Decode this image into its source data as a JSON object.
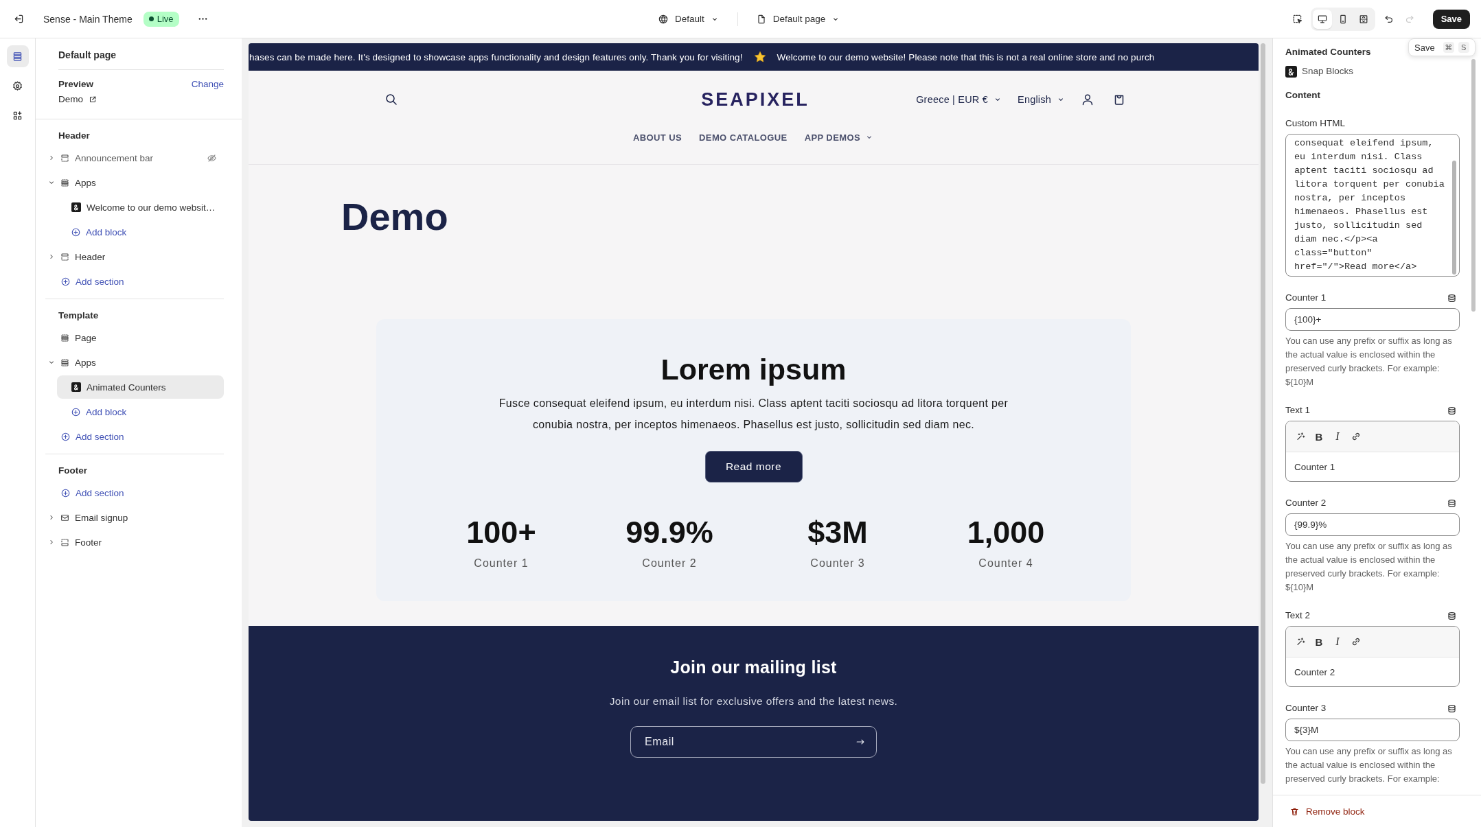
{
  "top_bar": {
    "theme_name": "Sense - Main Theme",
    "status_badge": "Live",
    "template_selector": "Default",
    "page_selector": "Default page",
    "view_modes": [
      {
        "kind": "desktop",
        "selected": true
      },
      {
        "kind": "mobile",
        "selected": false
      },
      {
        "kind": "fullscreen",
        "selected": false
      }
    ],
    "history": [
      {
        "kind": "undo",
        "disabled": false
      },
      {
        "kind": "redo",
        "disabled": true
      }
    ],
    "save_button": "Save"
  },
  "rail": [
    {
      "kind": "sections",
      "selected": true
    },
    {
      "kind": "settings",
      "selected": false
    },
    {
      "kind": "apps",
      "selected": false
    }
  ],
  "sidebar": {
    "title": "Default page",
    "preview": {
      "label": "Preview",
      "action": "Change",
      "value": "Demo"
    },
    "groups": [
      {
        "heading": "Header",
        "items": [
          {
            "kind": "announcement",
            "label": "Announcement bar",
            "expanded": false,
            "hidden": true
          },
          {
            "kind": "apps",
            "label": "Apps",
            "expanded": true,
            "hidden": false,
            "children": [
              {
                "kind": "block",
                "label": "Welcome to our demo websit…",
                "selected": false
              },
              {
                "kind": "add",
                "label": "Add block"
              }
            ]
          },
          {
            "kind": "header",
            "label": "Header",
            "expanded": false,
            "hidden": false
          },
          {
            "kind": "add",
            "label": "Add section"
          }
        ]
      },
      {
        "heading": "Template",
        "items": [
          {
            "kind": "page",
            "label": "Page",
            "hidden": false
          },
          {
            "kind": "apps",
            "label": "Apps",
            "expanded": true,
            "hidden": false,
            "children": [
              {
                "kind": "block",
                "label": "Animated Counters",
                "selected": true
              },
              {
                "kind": "add",
                "label": "Add block"
              }
            ]
          },
          {
            "kind": "add",
            "label": "Add section"
          }
        ]
      },
      {
        "heading": "Footer",
        "items": [
          {
            "kind": "add",
            "label": "Add section"
          },
          {
            "kind": "email",
            "label": "Email signup",
            "expanded": false,
            "hidden": false
          },
          {
            "kind": "footer",
            "label": "Footer",
            "expanded": false,
            "hidden": false
          }
        ]
      }
    ]
  },
  "preview": {
    "announcement_bar": {
      "messages": [
        "hases can be made here. It's designed to showcase apps functionality and design features only. Thank you for visiting!",
        "Welcome to our demo website! Please note that this is not a real online store and no purch"
      ]
    },
    "store_header": {
      "logo": "SEAPIXEL",
      "localization": [
        "Greece | EUR €",
        "English"
      ],
      "menu": [
        {
          "label": "ABOUT US",
          "dropdown": false
        },
        {
          "label": "DEMO CATALOGUE",
          "dropdown": false
        },
        {
          "label": "APP DEMOS",
          "dropdown": true
        }
      ]
    },
    "page_title": "Demo",
    "counters_block": {
      "heading": "Lorem ipsum",
      "text": "Fusce consequat eleifend ipsum, eu interdum nisi. Class aptent taciti sociosqu ad litora torquent per conubia nostra, per inceptos himenaeos. Phasellus est justo, sollicitudin sed diam nec.",
      "button": "Read more",
      "counters": [
        {
          "value": "100+",
          "label": "Counter 1"
        },
        {
          "value": "99.9%",
          "label": "Counter 2"
        },
        {
          "value": "$3M",
          "label": "Counter 3"
        },
        {
          "value": "1,000",
          "label": "Counter 4"
        }
      ]
    },
    "newsletter": {
      "heading": "Join our mailing list",
      "text": "Join our email list for exclusive offers and the latest news.",
      "email_placeholder": "Email"
    }
  },
  "block_settings": {
    "title": "Animated Counters",
    "app_name": "Snap Blocks",
    "section_heading": "Content",
    "fields": [
      {
        "kind": "code",
        "label": "Custom HTML",
        "value": "consequat eleifend ipsum,\neu interdum nisi. Class\naptent taciti sociosqu ad\nlitora torquent per conubia\nnostra, per inceptos\nhimenaeos. Phasellus est\njusto, sollicitudin sed\ndiam nec.</p><a\nclass=\"button\"\nhref=\"/\">Read more</a>",
        "dynamic_source": false
      },
      {
        "kind": "text",
        "label": "Counter 1",
        "value": "{100}+",
        "help": "You can use any prefix or suffix as long as the actual value is enclosed within the preserved curly brackets. For example: ${10}M",
        "dynamic_source": true
      },
      {
        "kind": "richtext",
        "label": "Text 1",
        "toolbar": [
          {
            "kind": "generate"
          },
          {
            "kind": "bold",
            "text": "B"
          },
          {
            "kind": "italic",
            "text": "I"
          },
          {
            "kind": "link"
          }
        ],
        "value": "Counter 1",
        "dynamic_source": true
      },
      {
        "kind": "text",
        "label": "Counter 2",
        "value": "{99.9}%",
        "help": "You can use any prefix or suffix as long as the actual value is enclosed within the preserved curly brackets. For example: ${10}M",
        "dynamic_source": true
      },
      {
        "kind": "richtext",
        "label": "Text 2",
        "toolbar": [
          {
            "kind": "generate"
          },
          {
            "kind": "bold",
            "text": "B"
          },
          {
            "kind": "italic",
            "text": "I"
          },
          {
            "kind": "link"
          }
        ],
        "value": "Counter 2",
        "dynamic_source": true
      },
      {
        "kind": "text",
        "label": "Counter 3",
        "value": "${3}M",
        "help": "You can use any prefix or suffix as long as the actual value is enclosed within the preserved curly brackets. For example:",
        "dynamic_source": true
      }
    ],
    "remove_button": "Remove block"
  },
  "save_tooltip": {
    "label": "Save",
    "keys": [
      "⌘",
      "S"
    ]
  }
}
